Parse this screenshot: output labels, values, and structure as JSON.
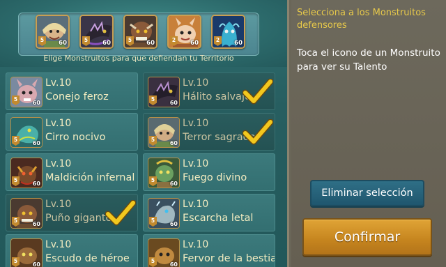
{
  "team": {
    "slots": [
      {
        "icon": "terror-sagrado-portrait",
        "stars": "5",
        "level": "60"
      },
      {
        "icon": "halito-salvaje-portrait",
        "stars": "5",
        "level": "60"
      },
      {
        "icon": "puno-gigante-portrait",
        "stars": "5",
        "level": "60"
      },
      {
        "icon": "conejo-portrait",
        "stars": "2",
        "level": "60"
      },
      {
        "icon": "fantasma-azul-portrait",
        "stars": "2",
        "level": "60"
      }
    ],
    "instruction": "Elige Monstruitos para que defiendan tu Territorio"
  },
  "monsters": [
    {
      "level": "Lv.10",
      "name": "Conejo feroz",
      "stars": "5",
      "mlevel": "60",
      "selected": false,
      "color": "#c9a0a8"
    },
    {
      "level": "Lv.10",
      "name": "Hálito salvaje",
      "stars": "5",
      "mlevel": "60",
      "selected": true,
      "color": "#4a3a5c"
    },
    {
      "level": "Lv.10",
      "name": "Cirro nocivo",
      "stars": "5",
      "mlevel": "60",
      "selected": false,
      "color": "#3a8a8a"
    },
    {
      "level": "Lv.10",
      "name": "Terror sagrado",
      "stars": "5",
      "mlevel": "60",
      "selected": true,
      "color": "#b89a6a"
    },
    {
      "level": "Lv.10",
      "name": "Maldición infernal",
      "stars": "5",
      "mlevel": "60",
      "selected": false,
      "color": "#7a4a2a"
    },
    {
      "level": "Lv.10",
      "name": "Fuego divino",
      "stars": "5",
      "mlevel": "60",
      "selected": false,
      "color": "#5a8a4a"
    },
    {
      "level": "Lv.10",
      "name": "Puño gigante",
      "stars": "5",
      "mlevel": "60",
      "selected": true,
      "color": "#8a5a3a"
    },
    {
      "level": "Lv.10",
      "name": "Escarcha letal",
      "stars": "5",
      "mlevel": "60",
      "selected": false,
      "color": "#8aa0a8"
    },
    {
      "level": "Lv.10",
      "name": "Escudo de héroe",
      "stars": "5",
      "mlevel": "60",
      "selected": false,
      "color": "#9a6a3a"
    },
    {
      "level": "Lv.10",
      "name": "Fervor de la bestia",
      "stars": "5",
      "mlevel": "60",
      "selected": false,
      "color": "#a07a3a"
    }
  ],
  "panel": {
    "title": "Selecciona a los Monstruitos defensores",
    "hint": "Toca el icono de un Monstruito para ver su Talento",
    "clear_label": "Eliminar selección",
    "confirm_label": "Confirmar"
  },
  "colors": {
    "accent": "#e7c94a",
    "confirm": "#d69a2e",
    "clear": "#2a6a82",
    "check": "#f2c81e"
  }
}
